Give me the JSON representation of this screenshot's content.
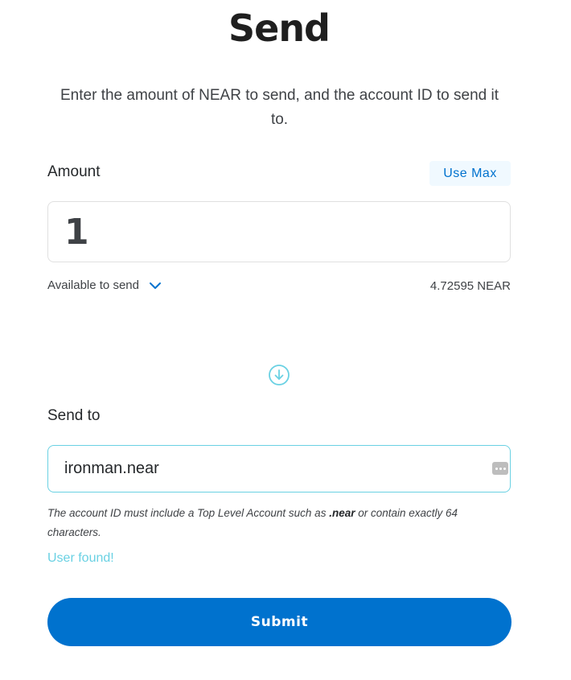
{
  "header": {
    "title": "Send",
    "subtitle": "Enter the amount of NEAR to send, and the account ID to send it to."
  },
  "amount": {
    "label": "Amount",
    "use_max_label": "Use Max",
    "value": "1",
    "available_label": "Available to send",
    "available_value": "4.72595 NEAR"
  },
  "icons": {
    "available_toggle": "chevron-down-icon",
    "divider": "arrow-down-circle-icon",
    "autofill": "more-dots-icon"
  },
  "send_to": {
    "label": "Send to",
    "value": "ironman.near",
    "hint_prefix": "The account ID must include a Top Level Account such as ",
    "hint_bold": ".near",
    "hint_suffix": " or contain exactly 64 characters.",
    "status": "User found!"
  },
  "submit": {
    "label": "Submit"
  },
  "colors": {
    "primary": "#0072ce",
    "success": "#6ad1e3",
    "use_max_bg": "#f0f9ff"
  }
}
